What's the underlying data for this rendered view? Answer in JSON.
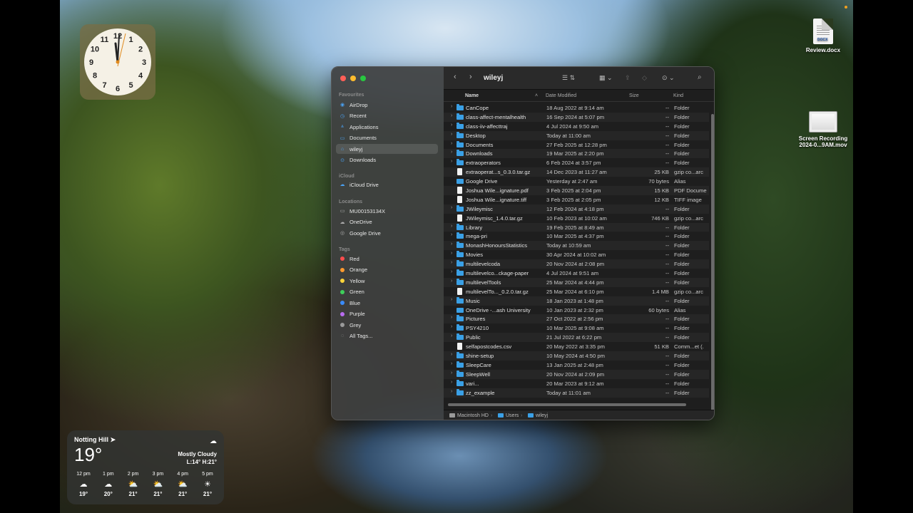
{
  "desktop": {
    "icons": [
      {
        "label": "Review.docx",
        "doc_tag": "DOCX"
      },
      {
        "label_line1": "Screen Recording",
        "label_line2": "2024-0...9AM.mov"
      }
    ]
  },
  "clock": {
    "numerals": [
      "12",
      "1",
      "2",
      "3",
      "4",
      "5",
      "6",
      "7",
      "8",
      "9",
      "10",
      "11"
    ]
  },
  "weather": {
    "location": "Notting Hill",
    "location_icon": "location-arrow-icon",
    "temp": "19°",
    "condition": "Mostly Cloudy",
    "low_high": "L:14° H:21°",
    "hours": [
      {
        "time": "12 pm",
        "icon": "cloud-icon",
        "temp": "19°"
      },
      {
        "time": "1 pm",
        "icon": "cloud-icon",
        "temp": "20°"
      },
      {
        "time": "2 pm",
        "icon": "partly-cloudy-icon",
        "temp": "21°"
      },
      {
        "time": "3 pm",
        "icon": "partly-cloudy-icon",
        "temp": "21°"
      },
      {
        "time": "4 pm",
        "icon": "partly-cloudy-icon",
        "temp": "21°"
      },
      {
        "time": "5 pm",
        "icon": "sun-icon",
        "temp": "21°"
      }
    ]
  },
  "finder": {
    "title": "wileyj",
    "sidebar": {
      "favourites_label": "Favourites",
      "favourites": [
        "AirDrop",
        "Recent",
        "Applications",
        "Documents",
        "wileyj",
        "Downloads"
      ],
      "icloud_label": "iCloud",
      "icloud": [
        "iCloud Drive"
      ],
      "locations_label": "Locations",
      "locations": [
        "MU00153134X",
        "OneDrive",
        "Google Drive"
      ],
      "tags_label": "Tags",
      "tags": [
        {
          "label": "Red",
          "color": "#ff4d4d"
        },
        {
          "label": "Orange",
          "color": "#ff9a2e"
        },
        {
          "label": "Yellow",
          "color": "#ffd43a"
        },
        {
          "label": "Green",
          "color": "#3ecf5a"
        },
        {
          "label": "Blue",
          "color": "#3a8cff"
        },
        {
          "label": "Purple",
          "color": "#b86cf0"
        },
        {
          "label": "Grey",
          "color": "#9a9a9a"
        },
        {
          "label": "All Tags...",
          "color": ""
        }
      ]
    },
    "columns": {
      "name": "Name",
      "date": "Date Modified",
      "size": "Size",
      "kind": "Kind"
    },
    "rows": [
      {
        "name": "CanCope",
        "date": "18 Aug 2022 at 9:14 am",
        "size": "--",
        "kind": "Folder",
        "type": "folder",
        "expandable": true
      },
      {
        "name": "class-affect-mentalhealth",
        "date": "16 Sep 2024 at 5:07 pm",
        "size": "--",
        "kind": "Folder",
        "type": "folder",
        "expandable": true
      },
      {
        "name": "class-iiv-affecttraj",
        "date": "4 Jul 2024 at 9:50 am",
        "size": "--",
        "kind": "Folder",
        "type": "folder",
        "expandable": true
      },
      {
        "name": "Desktop",
        "date": "Today at 11:00 am",
        "size": "--",
        "kind": "Folder",
        "type": "folder",
        "expandable": true
      },
      {
        "name": "Documents",
        "date": "27 Feb 2025 at 12:28 pm",
        "size": "--",
        "kind": "Folder",
        "type": "folder",
        "expandable": true
      },
      {
        "name": "Downloads",
        "date": "19 Mar 2025 at 2:20 pm",
        "size": "--",
        "kind": "Folder",
        "type": "folder",
        "expandable": true
      },
      {
        "name": "extraoperators",
        "date": "6 Feb 2024 at 3:57 pm",
        "size": "--",
        "kind": "Folder",
        "type": "folder",
        "expandable": true
      },
      {
        "name": "extraoperat...s_0.3.0.tar.gz",
        "date": "14 Dec 2023 at 11:27 am",
        "size": "25 KB",
        "kind": "gzip co...arc",
        "type": "file",
        "expandable": false
      },
      {
        "name": "Google Drive",
        "date": "Yesterday at 2:47 am",
        "size": "70 bytes",
        "kind": "Alias",
        "type": "alias",
        "expandable": false
      },
      {
        "name": "Joshua Wile...ignature.pdf",
        "date": "3 Feb 2025 at 2:04 pm",
        "size": "15 KB",
        "kind": "PDF Docume",
        "type": "file",
        "expandable": false
      },
      {
        "name": "Joshua Wile...ignature.tiff",
        "date": "3 Feb 2025 at 2:05 pm",
        "size": "12 KB",
        "kind": "TIFF image",
        "type": "file",
        "expandable": false
      },
      {
        "name": "JWileymisc",
        "date": "12 Feb 2024 at 4:18 pm",
        "size": "--",
        "kind": "Folder",
        "type": "folder",
        "expandable": true
      },
      {
        "name": "JWileymisc_1.4.0.tar.gz",
        "date": "10 Feb 2023 at 10:02 am",
        "size": "746 KB",
        "kind": "gzip co...arc",
        "type": "file",
        "expandable": false
      },
      {
        "name": "Library",
        "date": "19 Feb 2025 at 8:49 am",
        "size": "--",
        "kind": "Folder",
        "type": "folder",
        "expandable": true
      },
      {
        "name": "mega-pri",
        "date": "10 Mar 2025 at 4:37 pm",
        "size": "--",
        "kind": "Folder",
        "type": "folder",
        "expandable": true
      },
      {
        "name": "MonashHonoursStatistics",
        "date": "Today at 10:59 am",
        "size": "--",
        "kind": "Folder",
        "type": "folder",
        "expandable": true
      },
      {
        "name": "Movies",
        "date": "30 Apr 2024 at 10:02 am",
        "size": "--",
        "kind": "Folder",
        "type": "folder",
        "expandable": true
      },
      {
        "name": "multilevelcoda",
        "date": "20 Nov 2024 at 2:08 pm",
        "size": "--",
        "kind": "Folder",
        "type": "folder",
        "expandable": true
      },
      {
        "name": "multilevelco...ckage-paper",
        "date": "4 Jul 2024 at 9:51 am",
        "size": "--",
        "kind": "Folder",
        "type": "folder",
        "expandable": true
      },
      {
        "name": "multilevelTools",
        "date": "25 Mar 2024 at 4:44 pm",
        "size": "--",
        "kind": "Folder",
        "type": "folder",
        "expandable": true
      },
      {
        "name": "multilevelTo..._0.2.0.tar.gz",
        "date": "25 Mar 2024 at 6:10 pm",
        "size": "1.4 MB",
        "kind": "gzip co...arc",
        "type": "file",
        "expandable": false
      },
      {
        "name": "Music",
        "date": "18 Jan 2023 at 1:48 pm",
        "size": "--",
        "kind": "Folder",
        "type": "folder",
        "expandable": true
      },
      {
        "name": "OneDrive -...ash University",
        "date": "10 Jan 2023 at 2:32 pm",
        "size": "60 bytes",
        "kind": "Alias",
        "type": "alias",
        "expandable": false
      },
      {
        "name": "Pictures",
        "date": "27 Oct 2022 at 2:56 pm",
        "size": "--",
        "kind": "Folder",
        "type": "folder",
        "expandable": true
      },
      {
        "name": "PSY4210",
        "date": "10 Mar 2025 at 9:08 am",
        "size": "--",
        "kind": "Folder",
        "type": "folder",
        "expandable": true
      },
      {
        "name": "Public",
        "date": "21 Jul 2022 at 6:22 pm",
        "size": "--",
        "kind": "Folder",
        "type": "folder",
        "expandable": true
      },
      {
        "name": "selfapostcodes.csv",
        "date": "20 May 2022 at 3:35 pm",
        "size": "51 KB",
        "kind": "Comm...et (.",
        "type": "file",
        "expandable": false
      },
      {
        "name": "shine-setup",
        "date": "10 May 2024 at 4:50 pm",
        "size": "--",
        "kind": "Folder",
        "type": "folder",
        "expandable": true
      },
      {
        "name": "SleepCare",
        "date": "13 Jan 2025 at 2:48 pm",
        "size": "--",
        "kind": "Folder",
        "type": "folder",
        "expandable": true
      },
      {
        "name": "SleepWell",
        "date": "20 Nov 2024 at 2:09 pm",
        "size": "--",
        "kind": "Folder",
        "type": "folder",
        "expandable": true
      },
      {
        "name": "vari...",
        "date": "20 Mar 2023 at 9:12 am",
        "size": "--",
        "kind": "Folder",
        "type": "folder",
        "expandable": true
      },
      {
        "name": "zz_example",
        "date": "Today at 11:01 am",
        "size": "--",
        "kind": "Folder",
        "type": "folder",
        "expandable": true
      }
    ],
    "pathbar": [
      "Macintosh HD",
      "Users",
      "wileyj"
    ]
  }
}
